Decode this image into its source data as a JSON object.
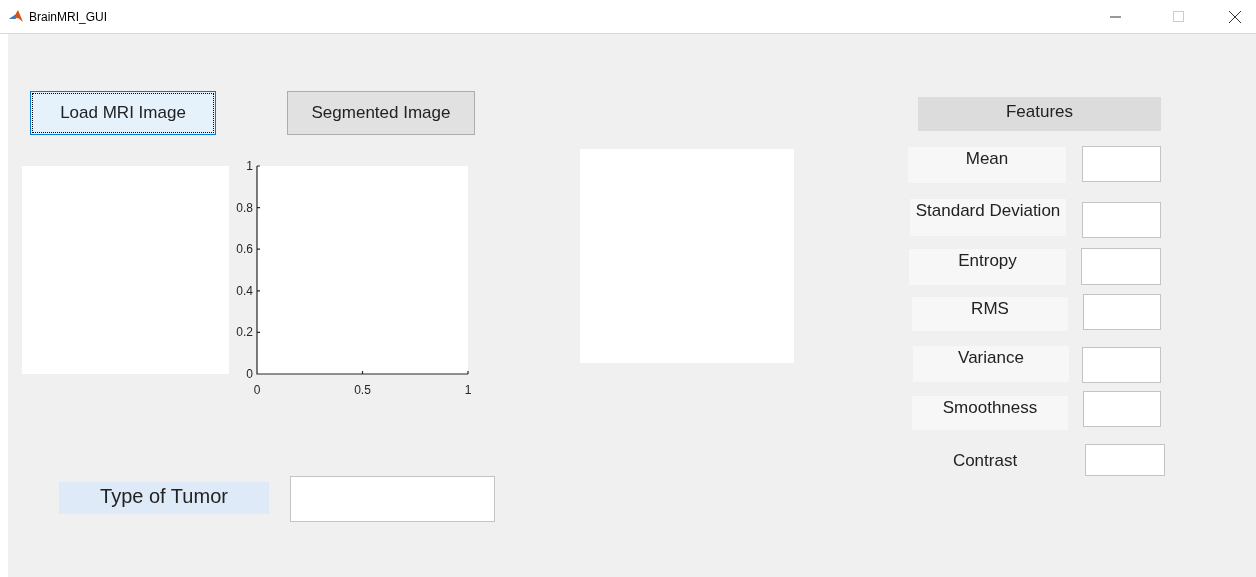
{
  "window": {
    "title": "BrainMRI_GUI"
  },
  "buttons": [
    {
      "label": "Load MRI Image",
      "focused": true
    },
    {
      "label": "Segmented Image",
      "focused": false
    }
  ],
  "axes": {
    "chart_data": {
      "type": "line",
      "xlim": [
        0,
        1
      ],
      "ylim": [
        0,
        1
      ],
      "xticks": [
        0,
        0.5,
        1
      ],
      "yticks": [
        0,
        0.2,
        0.4,
        0.6,
        0.8,
        1
      ]
    }
  },
  "features": {
    "title": "Features",
    "rows": [
      {
        "label": "Mean",
        "kind": "boxed"
      },
      {
        "label": "Standard Deviation",
        "kind": "boxed"
      },
      {
        "label": "Entropy",
        "kind": "boxed"
      },
      {
        "label": "RMS",
        "kind": "boxed"
      },
      {
        "label": "Variance",
        "kind": "boxed"
      },
      {
        "label": "Smoothness",
        "kind": "boxed"
      },
      {
        "label": "Contrast",
        "kind": "plain"
      }
    ]
  },
  "tumor": {
    "label": "Type of Tumor"
  }
}
